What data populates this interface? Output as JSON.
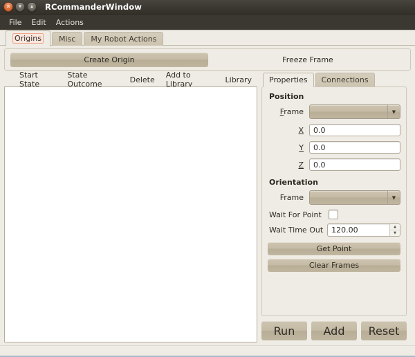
{
  "window": {
    "title": "RCommanderWindow",
    "controls": {
      "close": "×",
      "minimize": "▾",
      "maximize": "▴"
    }
  },
  "menubar": {
    "items": [
      {
        "label": "File"
      },
      {
        "label": "Edit"
      },
      {
        "label": "Actions"
      }
    ]
  },
  "tabs": {
    "items": [
      {
        "label": "Origins",
        "active": true
      },
      {
        "label": "Misc",
        "active": false
      },
      {
        "label": "My Robot Actions",
        "active": false
      }
    ]
  },
  "toolbar": {
    "create_origin_label": "Create Origin",
    "freeze_frame_label": "Freeze Frame"
  },
  "canvas_toolbar": {
    "items": [
      {
        "label": "Start State"
      },
      {
        "label": "State Outcome"
      },
      {
        "label": "Delete"
      },
      {
        "label": "Add to Library"
      },
      {
        "label": "Library"
      }
    ]
  },
  "properties": {
    "tabs": [
      {
        "label": "Properties",
        "active": true
      },
      {
        "label": "Connections",
        "active": false
      }
    ],
    "position": {
      "title": "Position",
      "frame_label": "Frame",
      "frame_mnemonic": "F",
      "frame_value": "",
      "fields": [
        {
          "label": "X",
          "value": "0.0"
        },
        {
          "label": "Y",
          "value": "0.0"
        },
        {
          "label": "Z",
          "value": "0.0"
        }
      ]
    },
    "orientation": {
      "title": "Orientation",
      "frame_label": "Frame",
      "frame_value": ""
    },
    "wait_for_point": {
      "label": "Wait For Point",
      "checked": false
    },
    "wait_time_out": {
      "label": "Wait Time Out",
      "value": "120.00"
    },
    "buttons": [
      {
        "label": "Get Point"
      },
      {
        "label": "Clear Frames"
      }
    ]
  },
  "actions": {
    "run_label": "Run",
    "add_label": "Add",
    "reset_label": "Reset"
  },
  "colors": {
    "titlebar": "#3b3832",
    "panel": "#efece5",
    "button": "#c5bba5",
    "canvas": "#ffffff",
    "accent": "#e0703a",
    "focus_ring": "#f0a48a"
  }
}
